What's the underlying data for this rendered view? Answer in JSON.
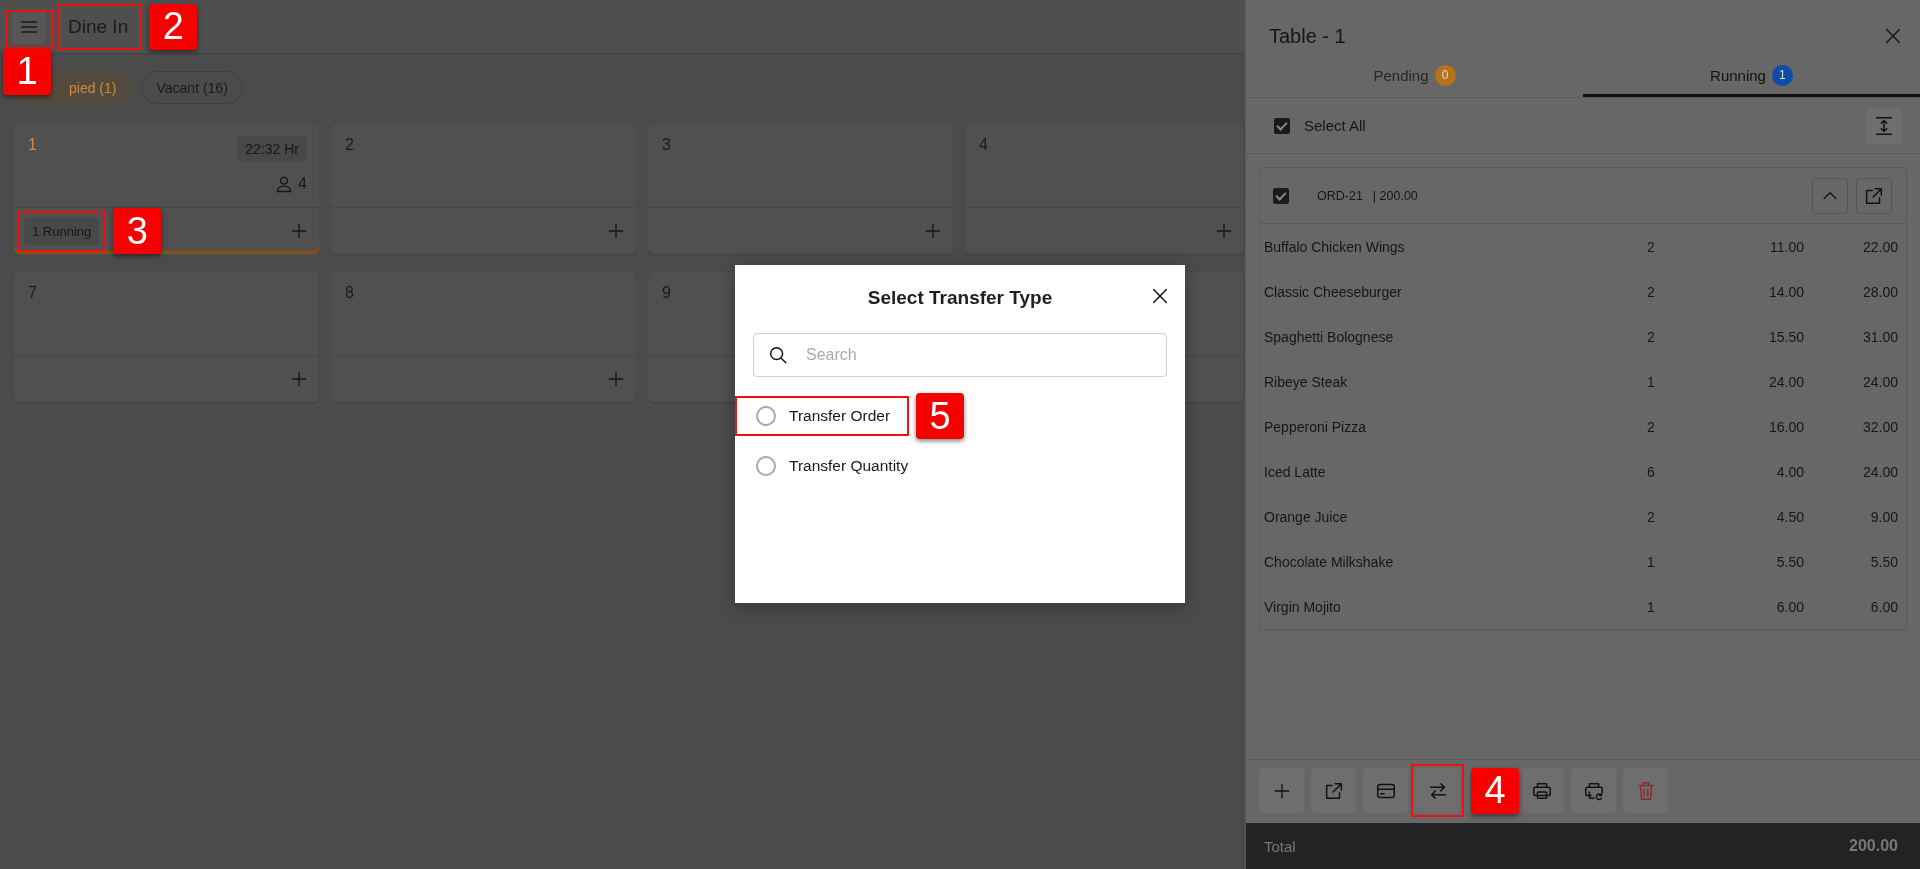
{
  "header": {
    "title": "Dine In",
    "menu_annotation": "1",
    "title_annotation": "2"
  },
  "filters": [
    {
      "label": "pied (1)",
      "selected": true
    },
    {
      "label": "Vacant (16)",
      "selected": false
    }
  ],
  "tables": [
    {
      "number": "1",
      "occupied": true,
      "time": "22:32 Hr",
      "guests": "4",
      "status": "1 Running",
      "status_annotation": "3"
    },
    {
      "number": "2",
      "occupied": false
    },
    {
      "number": "3",
      "occupied": false
    },
    {
      "number": "4",
      "occupied": false
    },
    {
      "number": "7",
      "occupied": false
    },
    {
      "number": "8",
      "occupied": false
    },
    {
      "number": "9",
      "occupied": false
    },
    {
      "occupied": false
    }
  ],
  "panel": {
    "title": "Table - 1",
    "tabs": [
      {
        "label": "Pending",
        "count": "0",
        "color": "#b8711c",
        "selected": false
      },
      {
        "label": "Running",
        "count": "1",
        "color": "#0c4ea6",
        "selected": true
      }
    ],
    "select_all": {
      "label": "Select All",
      "checked": true
    },
    "order": {
      "id": "ORD-21",
      "amount": "| 200.00",
      "checked": true,
      "expanded": true,
      "items": [
        {
          "name": "Buffalo Chicken Wings",
          "qty": "2",
          "price": "11.00",
          "total": "22.00"
        },
        {
          "name": "Classic Cheeseburger",
          "qty": "2",
          "price": "14.00",
          "total": "28.00"
        },
        {
          "name": "Spaghetti Bolognese",
          "qty": "2",
          "price": "15.50",
          "total": "31.00"
        },
        {
          "name": "Ribeye Steak",
          "qty": "1",
          "price": "24.00",
          "total": "24.00"
        },
        {
          "name": "Pepperoni Pizza",
          "qty": "2",
          "price": "16.00",
          "total": "32.00"
        },
        {
          "name": "Iced Latte",
          "qty": "6",
          "price": "4.00",
          "total": "24.00"
        },
        {
          "name": "Orange Juice",
          "qty": "2",
          "price": "4.50",
          "total": "9.00"
        },
        {
          "name": "Chocolate Milkshake",
          "qty": "1",
          "price": "5.50",
          "total": "5.50"
        },
        {
          "name": "Virgin Mojito",
          "qty": "1",
          "price": "6.00",
          "total": "6.00"
        }
      ]
    },
    "actions": [
      {
        "kind": "add"
      },
      {
        "kind": "open"
      },
      {
        "kind": "card"
      },
      {
        "kind": "transfer",
        "annotation": "4"
      },
      {
        "kind": "covered"
      },
      {
        "kind": "print"
      },
      {
        "kind": "reprint"
      },
      {
        "kind": "delete"
      }
    ],
    "total": {
      "label": "Total",
      "value": "200.00"
    }
  },
  "modal": {
    "title": "Select Transfer Type",
    "search": {
      "placeholder": "Search"
    },
    "options": [
      {
        "label": "Transfer Order",
        "selected": false,
        "annotation": "5"
      },
      {
        "label": "Transfer Quantity",
        "selected": false
      }
    ]
  }
}
